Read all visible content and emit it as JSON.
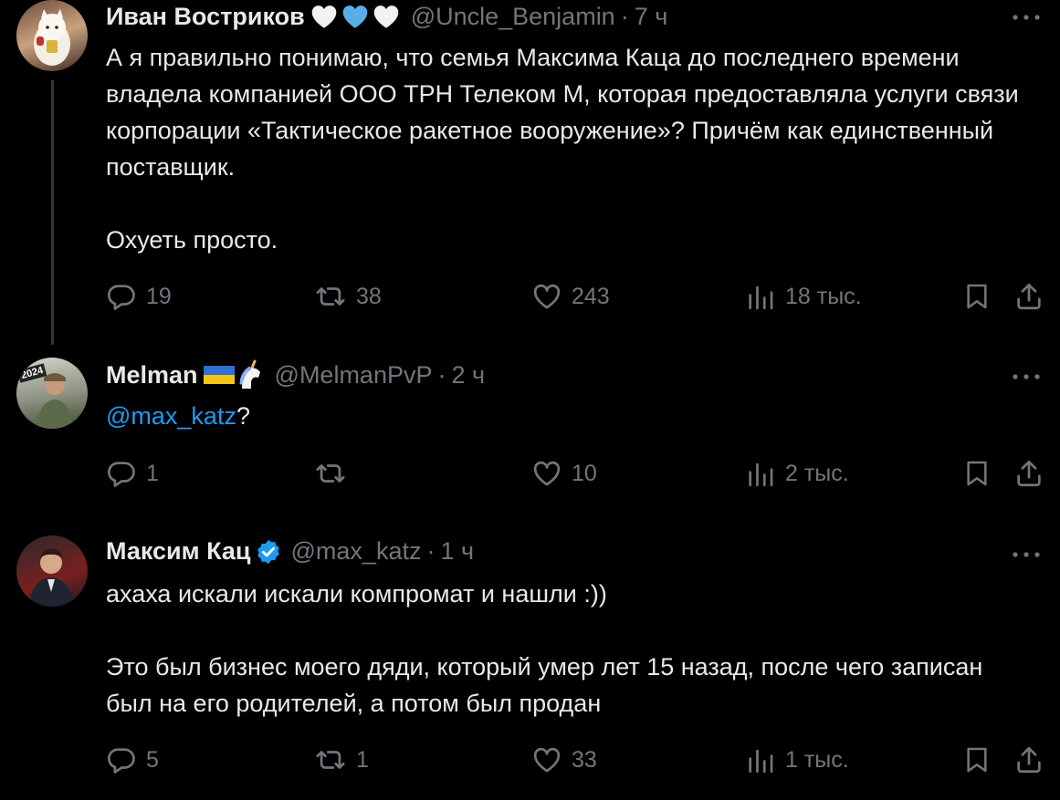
{
  "tweets": [
    {
      "name": "Иван Востриков",
      "handle": "@Uncle_Benjamin",
      "time": "7 ч",
      "emoji": [
        "white-heart",
        "blue-heart",
        "white-heart"
      ],
      "text": "А я правильно понимаю, что семья Максима Каца до последнего времени владела компанией ООО ТРН Телеком М, которая предоставляла услуги связи корпорации «Тактическое ракетное вооружение»? Причём как единственный поставщик.\n\nОхуеть просто.",
      "replies": "19",
      "retweets": "38",
      "likes": "243",
      "views": "18 тыс."
    },
    {
      "name": "Melman",
      "handle": "@MelmanPvP",
      "time": "2 ч",
      "emoji": [
        "ukraine-flag",
        "unicorn"
      ],
      "avatar_badge": "2024",
      "mention": "@max_katz",
      "text_after": "?",
      "replies": "1",
      "retweets": "",
      "likes": "10",
      "views": "2 тыс."
    },
    {
      "name": "Максим Кац",
      "handle": "@max_katz",
      "time": "1 ч",
      "emoji": [
        "verified-badge"
      ],
      "text": "ахаха искали искали компромат и нашли :))\n\nЭто был бизнес моего дяди, который умер лет 15 назад, после чего записан был на его родителей, а потом был продан",
      "replies": "5",
      "retweets": "1",
      "likes": "33",
      "views": "1 тыс."
    }
  ],
  "colors": {
    "background": "#000000",
    "text": "#e7e9ea",
    "muted": "#71767b",
    "link": "#1d9bf0",
    "thread_line": "#333639"
  },
  "icons": [
    "reply-icon",
    "retweet-icon",
    "like-icon",
    "views-icon",
    "bookmark-icon",
    "share-icon",
    "more-icon"
  ]
}
